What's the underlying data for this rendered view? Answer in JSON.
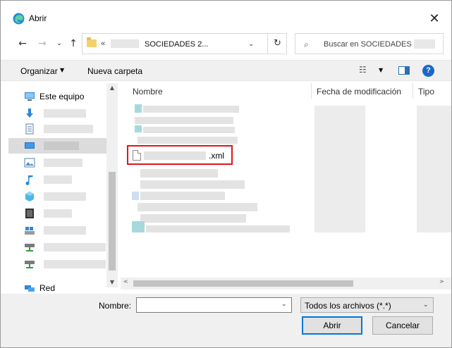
{
  "window": {
    "title": "Abrir",
    "close_glyph": "✕"
  },
  "nav": {
    "back_glyph": "←",
    "forward_glyph": "→",
    "recent_glyph": "⌄",
    "up_glyph": "↑",
    "breadcrumb_sep": "«",
    "breadcrumb_current": "SOCIEDADES 2...",
    "addr_dropdown_glyph": "⌄",
    "refresh_glyph": "↻",
    "search_placeholder": "Buscar en SOCIEDADES",
    "search_icon_glyph": "⌕"
  },
  "toolbar": {
    "organize_label": "Organizar",
    "organize_arrow": "▼",
    "new_folder_label": "Nueva carpeta",
    "view_glyph": "☷",
    "view_arrow": "▼",
    "help_glyph": "?"
  },
  "navpane": {
    "items": [
      {
        "label": "Este equipo",
        "icon": "computer-icon"
      },
      {
        "label": "",
        "icon": "downloads-icon"
      },
      {
        "label": "",
        "icon": "documents-icon"
      },
      {
        "label": "",
        "icon": "desktop-icon",
        "selected": true
      },
      {
        "label": "",
        "icon": "pictures-icon"
      },
      {
        "label": "",
        "icon": "music-icon"
      },
      {
        "label": "",
        "icon": "3d-objects-icon"
      },
      {
        "label": "",
        "icon": "videos-icon"
      },
      {
        "label": "",
        "icon": "os-drive-icon"
      },
      {
        "label": "",
        "icon": "network-drive-icon"
      },
      {
        "label": "",
        "icon": "network-drive-icon"
      },
      {
        "label": "Red",
        "icon": "network-icon"
      }
    ],
    "scroll_up_glyph": "▲",
    "scroll_down_glyph": "▼"
  },
  "filelist": {
    "columns": [
      "Nombre",
      "Fecha de modificación",
      "Tipo"
    ],
    "sort_glyph": "^",
    "highlighted_file_suffix": ".xml",
    "scroll_left_glyph": "<",
    "scroll_right_glyph": ">"
  },
  "bottom": {
    "name_label": "Nombre:",
    "name_value": "",
    "name_dropdown_glyph": "⌄",
    "filter_value": "Todos los archivos (*.*)",
    "filter_dropdown_glyph": "⌄",
    "open_label": "Abrir",
    "cancel_label": "Cancelar"
  },
  "colors": {
    "accent": "#0078d7",
    "highlight_border": "#e0141c",
    "toolbar_bg": "#f0f0f0"
  }
}
